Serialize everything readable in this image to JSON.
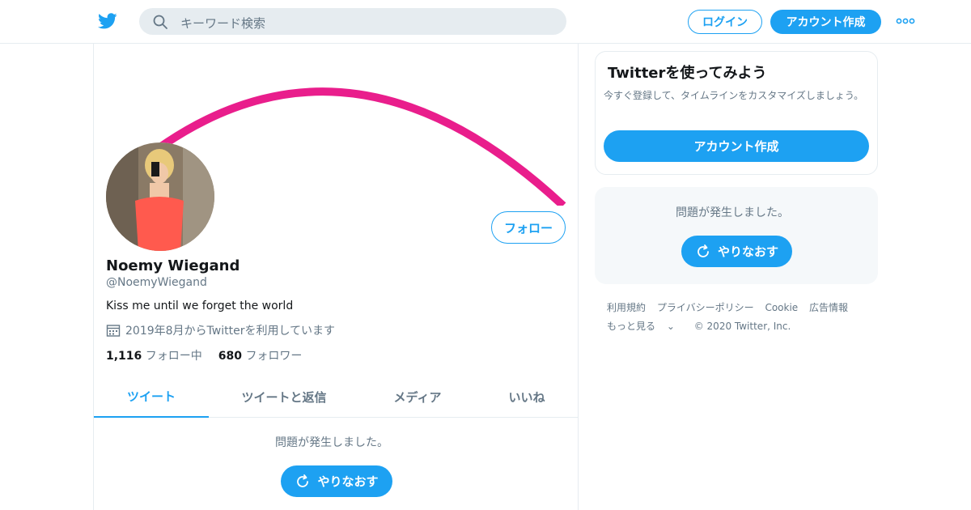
{
  "header": {
    "logo_icon": "twitter-bird-icon",
    "search_placeholder": "キーワード検索",
    "login_label": "ログイン",
    "signup_label": "アカウント作成",
    "more_icon": "more-dots-icon"
  },
  "profile": {
    "name": "Noemy Wiegand",
    "handle": "@NoemyWiegand",
    "bio": "Kiss me until we forget the world",
    "joined": "2019年8月からTwitterを利用しています",
    "following_count": "1,116",
    "following_label": "フォロー中",
    "followers_count": "680",
    "followers_label": "フォロワー",
    "follow_label": "フォロー"
  },
  "tabs": [
    {
      "label": "ツイート",
      "active": true
    },
    {
      "label": "ツイートと返信",
      "active": false
    },
    {
      "label": "メディア",
      "active": false
    },
    {
      "label": "いいね",
      "active": false
    }
  ],
  "timeline": {
    "error_text": "問題が発生しました。",
    "retry_label": "やりなおす"
  },
  "signup_card": {
    "title": "Twitterを使ってみよう",
    "subtitle": "今すぐ登録して、タイムラインをカスタマイズしましょう。",
    "button_label": "アカウント作成"
  },
  "trends": {
    "error_text": "問題が発生しました。",
    "retry_label": "やりなおす"
  },
  "footer": {
    "links": [
      "利用規約",
      "プライバシーポリシー",
      "Cookie",
      "広告情報"
    ],
    "more_label": "もっと見る",
    "copyright": "© 2020 Twitter, Inc."
  },
  "colors": {
    "accent": "#1da1f2",
    "banner_arc": "#e91e8c"
  }
}
